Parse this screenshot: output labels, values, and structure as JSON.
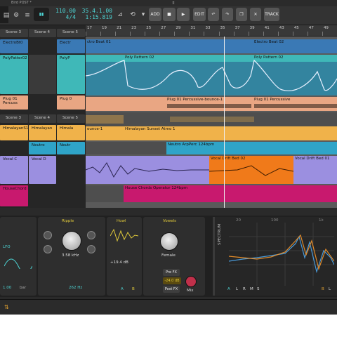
{
  "window": {
    "title": "Bird POST *"
  },
  "transport": {
    "tempo": "110.00",
    "time_signature": "4/4",
    "position_bars": "35.4.1.00",
    "position_time": "1:15.819",
    "buttons": {
      "add": "ADD",
      "edit": "EDIT",
      "track": "TRACK"
    }
  },
  "ruler": {
    "numbers": [
      "17",
      "19",
      "21",
      "23",
      "25",
      "27",
      "29",
      "31",
      "33",
      "35",
      "37",
      "39",
      "41",
      "43",
      "45",
      "47",
      "49"
    ]
  },
  "scenes": [
    "Scene 3",
    "Scene 4",
    "Scene 5"
  ],
  "launcher_rows": [
    {
      "cells": [
        "ElectroBt0",
        "",
        "Electr"
      ]
    },
    {
      "cells": [
        "PolyPatter02",
        "",
        "PolyP"
      ]
    },
    {
      "cells": [
        "",
        "",
        ""
      ]
    },
    {
      "cells": [
        "Plug 01 Percuss",
        "",
        "Plug 0"
      ]
    },
    {
      "scene_labels": [
        "Scene 3",
        "Scene 4",
        "Scene 5"
      ]
    },
    {
      "cells": [
        "HimalayanS1",
        "Himalayan",
        "Himala"
      ]
    },
    {
      "cells": [
        "",
        "Neutro",
        "Neutr"
      ]
    },
    {
      "cells": [
        "Vocal C",
        "Vocal D",
        ""
      ]
    },
    {
      "cells": [
        "HouseChord",
        "",
        ""
      ]
    }
  ],
  "arranger_clips": {
    "electro_beat_1": "ctro Beat 01",
    "electro_beat_2": "Electro Beat 02",
    "poly_pattern_2a": "Poly Pattern 02",
    "poly_pattern_2b": "Poly Pattern 02",
    "plug_bounce": "Plug 01 Percussive-bounce-1",
    "plug_percussive": "Plug 01 Percussive",
    "bounce": "ounce-1",
    "himalayan": "Himalayan Sunset Atmo 1",
    "neutro": "Neutro ArpPerc 124bpm",
    "vocal_drift_2": "Vocal Drift Bed 02",
    "vocal_drift_1": "Vocal Drift Bed 01",
    "house_chords": "House Chords Operator 124bpm"
  },
  "devices": {
    "ripple": {
      "title": "Ripple",
      "freq": "3.58 kHz"
    },
    "howl": {
      "title": "Howl",
      "gain": "+19.4 dB"
    },
    "vowels": {
      "title": "Vowels",
      "voice": "Female"
    },
    "lfo": {
      "label": "LFO",
      "rate": "1.00",
      "unit": "bar"
    },
    "freq2": "262 Hz",
    "ab": {
      "a": "A",
      "b": "B"
    },
    "fx": {
      "pre": "Pre FX",
      "level": "-24.0 dB",
      "post": "Post FX",
      "mix": "Mix"
    }
  },
  "spectrum": {
    "label": "SPECTRUM",
    "axis_top": [
      "20",
      "100",
      "1k"
    ],
    "channels": [
      "A",
      "L",
      "R",
      "M",
      "S"
    ],
    "right_channels": [
      "B",
      "L"
    ]
  },
  "colors": {
    "electro": "#3a79b5",
    "poly": "#3fb8b8",
    "plug": "#e9a683",
    "himalayan": "#f0b24a",
    "neutro": "#2fa4c8",
    "vocal": "#9b8fe0",
    "vocal_orange": "#f07a1a",
    "house": "#c8196e",
    "accent": "#4dd3d3"
  }
}
